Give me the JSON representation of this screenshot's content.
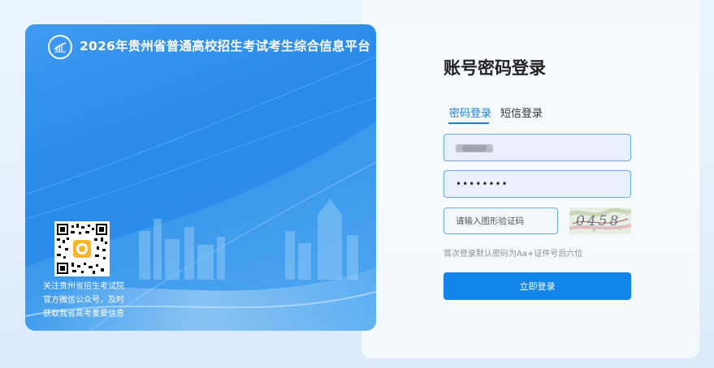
{
  "banner": {
    "title": "2026年贵州省普通高校招生考试考生综合信息平台",
    "qr_caption": [
      "关注贵州省招生考试院",
      "官方微信公众号，及时",
      "获取我省高考重要信息"
    ]
  },
  "login": {
    "title": "账号密码登录",
    "tabs": [
      {
        "label": "密码登录",
        "active": true
      },
      {
        "label": "短信登录",
        "active": false
      }
    ],
    "password_value": "••••••••",
    "captcha_placeholder": "请输入图形验证码",
    "captcha_text": "0458",
    "hint": "首次登录默认密码为Aa+证件号后六位",
    "submit_label": "立即登录"
  },
  "colors": {
    "accent": "#1285ea",
    "banner": "#2a8bea"
  },
  "icons": {
    "logo": "exam-institute-logo-icon",
    "qr": "qr-code"
  }
}
